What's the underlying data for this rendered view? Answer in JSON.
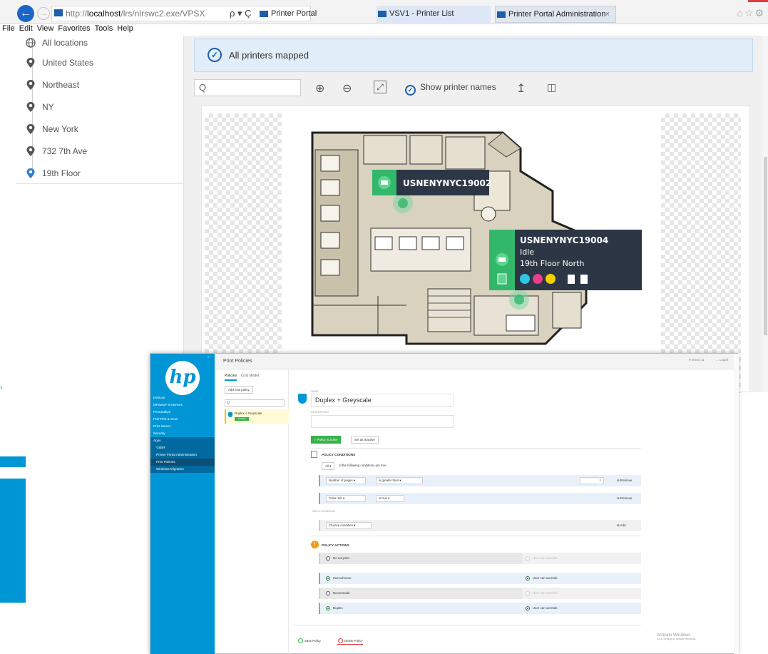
{
  "browser": {
    "address_prefix": "http://",
    "address_host": "localhost",
    "address_path": "/lrs/nlrswc2.exe/VPSX",
    "address_controls": "ρ ▾ Ç",
    "tabs": [
      {
        "label": "Printer Portal"
      },
      {
        "label": "VSV1 - Printer List"
      },
      {
        "label": "Printer Portal Administration",
        "close": "×"
      }
    ],
    "menu": [
      "File",
      "Edit",
      "View",
      "Favorites",
      "Tools",
      "Help"
    ],
    "right_icons": "⌂☆⚙"
  },
  "sidebar": {
    "locations": [
      {
        "label": "All locations",
        "icon": "globe-icon"
      },
      {
        "label": "United States",
        "icon": "pin-icon"
      },
      {
        "label": "Northeast",
        "icon": "pin-icon"
      },
      {
        "label": "NY",
        "icon": "pin-icon"
      },
      {
        "label": "New York",
        "icon": "pin-icon"
      },
      {
        "label": "732 7th Ave",
        "icon": "pin-icon"
      },
      {
        "label": "19th Floor",
        "icon": "pin-icon",
        "selected": true
      }
    ]
  },
  "map": {
    "banner": "All printers mapped",
    "search_placeholder": "",
    "search_icon": "Q",
    "show_printer_names": "Show printer names",
    "zoom_in": "⊕",
    "zoom_out": "⊖",
    "fit": "⤢",
    "upload": "↥",
    "trash": "🗑",
    "printer1": {
      "name": "USNENYNYC19002"
    },
    "printer2": {
      "name": "USNENYNYC19004",
      "status": "Idle",
      "location": "19th Floor North",
      "supply_colors": [
        "#2ec4e6",
        "#e83e8c",
        "#f5d000"
      ]
    },
    "accent": "#1d5faa",
    "printer_green": "#33b86b",
    "tooltip_bg": "#2c3645"
  },
  "hp": {
    "title": "Print Policies",
    "top_user": "WSGi\n11",
    "logoff": "Logoff",
    "collapse": "«",
    "logo": "hp",
    "nav": [
      "Devices",
      "MPSetuP II Devices",
      "PersonalQs",
      "Pull Print & Scan",
      "Print Server",
      "Security",
      "Apps",
      "VSBR",
      "Printer Portal Administration",
      "Print Policies",
      "Windows Migration"
    ],
    "tabs": [
      "Policies",
      "Cost Model"
    ],
    "add_policy": "Add new policy",
    "search_icon": "Q",
    "policy_item": {
      "name": "Duplex + Greyscale",
      "badge": "ACTIVE"
    },
    "name_label": "NAME",
    "policy_name": "Duplex + Greyscale",
    "description_label": "DESCRIPTION",
    "active_btn": "Policy is active",
    "inactive_btn": "Set as Inactive",
    "conditions_title": "POLICY CONDITIONS",
    "all_select": "All",
    "conditions_caption": "of the following conditions are true",
    "conditions": [
      {
        "field": "Number of pages",
        "op": "is greater than",
        "value": "1",
        "action": "Remove"
      },
      {
        "field": "Color Job",
        "op": "is true",
        "value": "",
        "action": "Remove"
      }
    ],
    "add_condition_label": "ADD A CONDITION",
    "choose_condition": "Choose condition",
    "add": "Add",
    "actions_title": "POLICY ACTIONS",
    "actions": [
      {
        "label": "Do not print",
        "override": "User can override",
        "checked": false
      },
      {
        "label": "Monochrome",
        "override": "User can override",
        "checked": true
      },
      {
        "label": "Economode",
        "override": "User can override",
        "checked": false
      },
      {
        "label": "Duplex",
        "override": "User can override",
        "checked": true
      }
    ],
    "save": "Save Policy",
    "delete": "Delete Policy",
    "activate_title": "Activate Windows",
    "activate_sub": "Go to Settings to activate Windows.",
    "brand_color": "#0096d6"
  }
}
